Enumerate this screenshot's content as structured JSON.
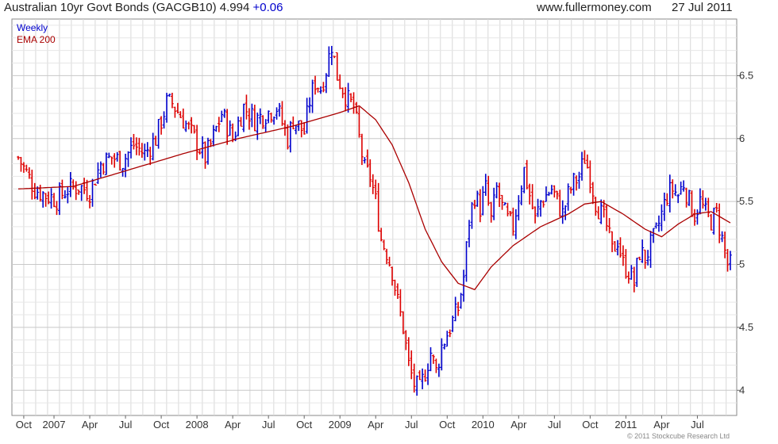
{
  "header": {
    "title": "Australian 10yr Govt Bonds (GACGB10) 4.994",
    "change": "+0.06",
    "site": "www.fullermoney.com",
    "date": "27 Jul 2011"
  },
  "legend": {
    "weekly": "Weekly",
    "ema": "EMA 200"
  },
  "copyright": "© 2011 Stockcube Research Ltd",
  "colors": {
    "up": "#0000cc",
    "down": "#dd0000",
    "ema": "#aa0000",
    "grid": "#d8d8d8"
  },
  "chart_data": {
    "type": "line",
    "title": "Australian 10yr Govt Bonds (GACGB10)",
    "ylim": [
      3.8,
      6.95
    ],
    "y_ticks": [
      4,
      4.5,
      5,
      5.5,
      6,
      6.5
    ],
    "y_tick_labels": [
      "4",
      "4.5",
      "5",
      "5.5",
      "6",
      "6.5"
    ],
    "x_tick_labels": [
      "Oct",
      "2007",
      "Apr",
      "Jul",
      "Oct",
      "2008",
      "Apr",
      "Jul",
      "Oct",
      "2009",
      "Apr",
      "Jul",
      "Oct",
      "2010",
      "Apr",
      "Jul",
      "Oct",
      "2011",
      "Apr",
      "Jul"
    ],
    "grid": true,
    "legend_position": "top-left",
    "series": [
      {
        "name": "Weekly",
        "style": "bars",
        "anchors": [
          [
            0,
            5.85
          ],
          [
            6,
            5.6
          ],
          [
            10,
            5.55
          ],
          [
            14,
            5.52
          ],
          [
            18,
            5.6
          ],
          [
            22,
            5.62
          ],
          [
            26,
            5.58
          ],
          [
            30,
            5.8
          ],
          [
            34,
            5.85
          ],
          [
            38,
            5.82
          ],
          [
            42,
            5.95
          ],
          [
            46,
            5.88
          ],
          [
            50,
            6.0
          ],
          [
            54,
            6.28
          ],
          [
            56,
            6.28
          ],
          [
            60,
            6.15
          ],
          [
            64,
            6.0
          ],
          [
            68,
            5.85
          ],
          [
            70,
            5.95
          ],
          [
            74,
            6.2
          ],
          [
            78,
            6.0
          ],
          [
            82,
            6.25
          ],
          [
            86,
            6.15
          ],
          [
            90,
            6.2
          ],
          [
            94,
            6.25
          ],
          [
            98,
            6.0
          ],
          [
            100,
            6.15
          ],
          [
            104,
            6.05
          ],
          [
            106,
            6.3
          ],
          [
            108,
            6.45
          ],
          [
            110,
            6.4
          ],
          [
            112,
            6.55
          ],
          [
            114,
            6.75
          ],
          [
            116,
            6.5
          ],
          [
            118,
            6.4
          ],
          [
            120,
            6.3
          ],
          [
            122,
            6.25
          ],
          [
            124,
            6.0
          ],
          [
            126,
            5.75
          ],
          [
            128,
            5.7
          ],
          [
            130,
            5.5
          ],
          [
            132,
            5.2
          ],
          [
            134,
            5.1
          ],
          [
            136,
            4.95
          ],
          [
            138,
            4.7
          ],
          [
            140,
            4.5
          ],
          [
            142,
            4.2
          ],
          [
            144,
            4.05
          ],
          [
            146,
            4.0
          ],
          [
            148,
            4.15
          ],
          [
            150,
            4.3
          ],
          [
            152,
            4.15
          ],
          [
            154,
            4.35
          ],
          [
            156,
            4.45
          ],
          [
            158,
            4.55
          ],
          [
            160,
            4.65
          ],
          [
            162,
            4.9
          ],
          [
            164,
            5.35
          ],
          [
            166,
            5.55
          ],
          [
            168,
            5.45
          ],
          [
            170,
            5.6
          ],
          [
            172,
            5.35
          ],
          [
            174,
            5.6
          ],
          [
            176,
            5.45
          ],
          [
            178,
            5.35
          ],
          [
            180,
            5.3
          ],
          [
            182,
            5.55
          ],
          [
            184,
            5.75
          ],
          [
            186,
            5.55
          ],
          [
            188,
            5.35
          ],
          [
            190,
            5.5
          ],
          [
            192,
            5.55
          ],
          [
            194,
            5.6
          ],
          [
            196,
            5.5
          ],
          [
            198,
            5.4
          ],
          [
            200,
            5.55
          ],
          [
            202,
            5.65
          ],
          [
            204,
            5.7
          ],
          [
            206,
            5.85
          ],
          [
            208,
            5.7
          ],
          [
            210,
            5.5
          ],
          [
            212,
            5.4
          ],
          [
            214,
            5.3
          ],
          [
            216,
            5.1
          ],
          [
            218,
            5.2
          ],
          [
            220,
            5.0
          ],
          [
            222,
            4.95
          ],
          [
            224,
            4.85
          ],
          [
            226,
            5.1
          ],
          [
            228,
            5.05
          ],
          [
            230,
            5.15
          ],
          [
            232,
            5.25
          ],
          [
            234,
            5.4
          ],
          [
            236,
            5.55
          ],
          [
            238,
            5.6
          ],
          [
            240,
            5.55
          ],
          [
            242,
            5.65
          ],
          [
            244,
            5.5
          ],
          [
            246,
            5.4
          ],
          [
            248,
            5.5
          ],
          [
            250,
            5.4
          ],
          [
            252,
            5.35
          ],
          [
            254,
            5.4
          ],
          [
            256,
            5.2
          ],
          [
            258,
            5.0
          ],
          [
            259,
            4.99
          ]
        ]
      },
      {
        "name": "EMA 200",
        "style": "line",
        "anchors": [
          [
            0,
            5.6
          ],
          [
            20,
            5.62
          ],
          [
            40,
            5.75
          ],
          [
            60,
            5.88
          ],
          [
            80,
            6.0
          ],
          [
            100,
            6.1
          ],
          [
            116,
            6.2
          ],
          [
            124,
            6.26
          ],
          [
            130,
            6.15
          ],
          [
            136,
            5.95
          ],
          [
            142,
            5.65
          ],
          [
            148,
            5.28
          ],
          [
            154,
            5.02
          ],
          [
            160,
            4.85
          ],
          [
            166,
            4.8
          ],
          [
            172,
            4.98
          ],
          [
            180,
            5.15
          ],
          [
            190,
            5.3
          ],
          [
            200,
            5.4
          ],
          [
            206,
            5.48
          ],
          [
            212,
            5.5
          ],
          [
            220,
            5.4
          ],
          [
            228,
            5.28
          ],
          [
            234,
            5.22
          ],
          [
            240,
            5.32
          ],
          [
            246,
            5.4
          ],
          [
            252,
            5.42
          ],
          [
            259,
            5.33
          ]
        ]
      }
    ]
  }
}
